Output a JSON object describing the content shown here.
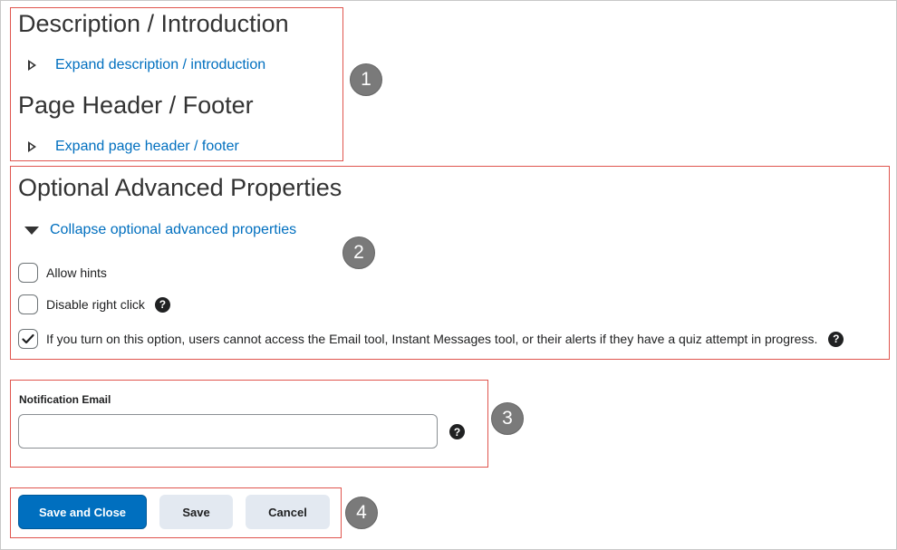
{
  "sections": {
    "description": {
      "heading": "Description / Introduction",
      "toggle_label": "Expand description / introduction"
    },
    "header_footer": {
      "heading": "Page Header / Footer",
      "toggle_label": "Expand page header / footer"
    },
    "advanced": {
      "heading": "Optional Advanced Properties",
      "toggle_label": "Collapse optional advanced properties",
      "options": [
        {
          "label": "Allow hints",
          "checked": false
        },
        {
          "label": "Disable right click",
          "checked": false,
          "help": true
        },
        {
          "label": "If you turn on this option, users cannot access the Email tool, Instant Messages tool, or their alerts if they have a quiz attempt in progress.",
          "checked": true,
          "help": true
        }
      ]
    }
  },
  "notification": {
    "label": "Notification Email",
    "value": "",
    "placeholder": ""
  },
  "buttons": {
    "save_close": "Save and Close",
    "save": "Save",
    "cancel": "Cancel"
  },
  "help_glyph": "?",
  "callouts": [
    "1",
    "2",
    "3",
    "4"
  ],
  "colors": {
    "link": "#006fbf",
    "primary_button": "#006fbf",
    "secondary_button": "#e3e9f1",
    "callout_border": "#e0554e",
    "badge": "#7a7a7a"
  }
}
